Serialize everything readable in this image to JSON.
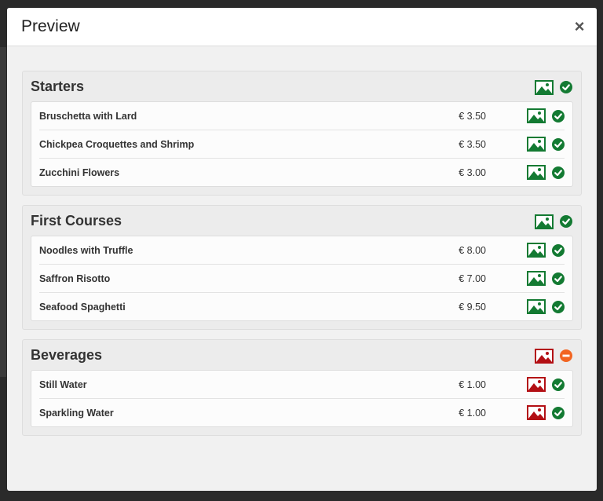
{
  "modal": {
    "title": "Preview",
    "close_label": "×"
  },
  "colors": {
    "ok_green": "#137a32",
    "warn_red": "#b30f14",
    "blocked_orange": "#f26522"
  },
  "sections": [
    {
      "title": "Starters",
      "image_status": "ok",
      "availability": "ok",
      "items": [
        {
          "name": "Bruschetta with Lard",
          "price": "€ 3.50",
          "image_status": "ok",
          "availability": "ok"
        },
        {
          "name": "Chickpea Croquettes and Shrimp",
          "price": "€ 3.50",
          "image_status": "ok",
          "availability": "ok"
        },
        {
          "name": "Zucchini Flowers",
          "price": "€ 3.00",
          "image_status": "ok",
          "availability": "ok"
        }
      ]
    },
    {
      "title": "First Courses",
      "image_status": "ok",
      "availability": "ok",
      "items": [
        {
          "name": "Noodles with Truffle",
          "price": "€ 8.00",
          "image_status": "ok",
          "availability": "ok"
        },
        {
          "name": "Saffron Risotto",
          "price": "€ 7.00",
          "image_status": "ok",
          "availability": "ok"
        },
        {
          "name": "Seafood Spaghetti",
          "price": "€ 9.50",
          "image_status": "ok",
          "availability": "ok"
        }
      ]
    },
    {
      "title": "Beverages",
      "image_status": "missing",
      "availability": "blocked",
      "items": [
        {
          "name": "Still Water",
          "price": "€ 1.00",
          "image_status": "missing",
          "availability": "ok"
        },
        {
          "name": "Sparkling Water",
          "price": "€ 1.00",
          "image_status": "missing",
          "availability": "ok"
        }
      ]
    }
  ]
}
